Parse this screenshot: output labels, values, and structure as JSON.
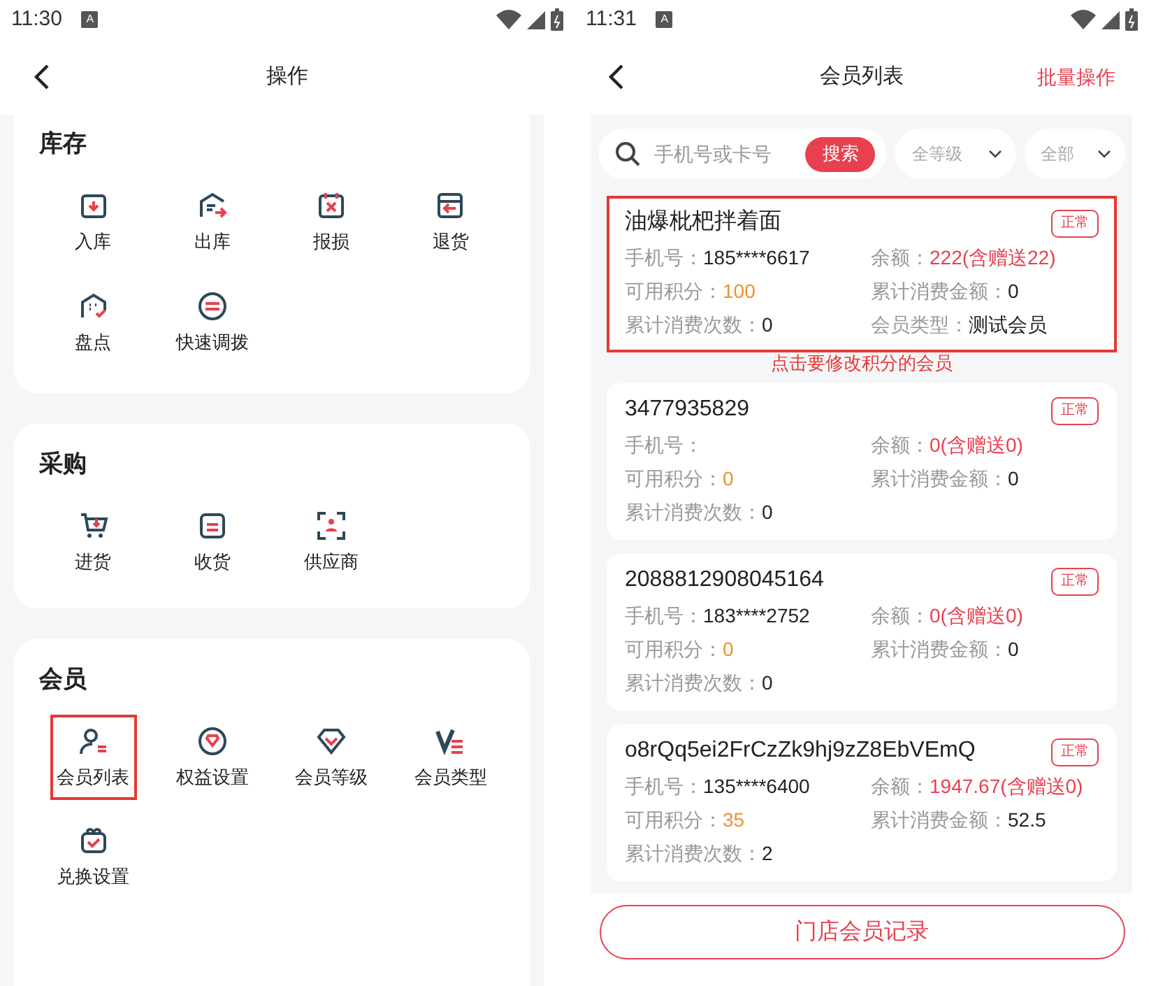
{
  "screens": [
    {
      "status_bar": {
        "time": "11:30",
        "notification": "A"
      },
      "header": {
        "title": "操作"
      },
      "sections": [
        {
          "title": "库存",
          "items": [
            {
              "label": "入库",
              "highlighted": false
            },
            {
              "label": "出库",
              "highlighted": false
            },
            {
              "label": "报损",
              "highlighted": false
            },
            {
              "label": "退货",
              "highlighted": false
            },
            {
              "label": "盘点",
              "highlighted": false
            },
            {
              "label": "快速调拨",
              "highlighted": false
            }
          ]
        },
        {
          "title": "采购",
          "items": [
            {
              "label": "进货",
              "highlighted": false
            },
            {
              "label": "收货",
              "highlighted": false
            },
            {
              "label": "供应商",
              "highlighted": false
            }
          ]
        },
        {
          "title": "会员",
          "items": [
            {
              "label": "会员列表",
              "highlighted": true
            },
            {
              "label": "权益设置",
              "highlighted": false
            },
            {
              "label": "会员等级",
              "highlighted": false
            },
            {
              "label": "会员类型",
              "highlighted": false
            },
            {
              "label": "兑换设置",
              "highlighted": false
            }
          ]
        }
      ]
    },
    {
      "status_bar": {
        "time": "11:31",
        "notification": "A"
      },
      "header": {
        "title": "会员列表",
        "action": "批量操作"
      },
      "search": {
        "placeholder": "手机号或卡号",
        "button": "搜索"
      },
      "filters": [
        "全等级",
        "全部"
      ],
      "members": [
        {
          "name": "油爆枇杷拌着面",
          "status": "正常",
          "highlighted": true,
          "fields": [
            {
              "label": "手机号：",
              "value": "185****6617",
              "kind": "plain"
            },
            {
              "label": "余额：",
              "value": "222(含赠送22)",
              "kind": "balance"
            },
            {
              "label": "可用积分：",
              "value": "100",
              "kind": "points"
            },
            {
              "label": "累计消费金额：",
              "value": "0",
              "kind": "plain"
            },
            {
              "label": "累计消费次数：",
              "value": "0",
              "kind": "plain"
            },
            {
              "label": "会员类型：",
              "value": "测试会员",
              "kind": "plain"
            }
          ]
        },
        {
          "name": "3477935829",
          "status": "正常",
          "highlighted": false,
          "fields": [
            {
              "label": "手机号：",
              "kind": "plain"
            },
            {
              "label": "余额：",
              "value": "0(含赠送0)",
              "kind": "balance"
            },
            {
              "label": "可用积分：",
              "value": "0",
              "kind": "points"
            },
            {
              "label": "累计消费金额：",
              "value": "0",
              "kind": "plain"
            },
            {
              "label": "累计消费次数：",
              "value": "0",
              "kind": "plain"
            }
          ]
        },
        {
          "name": "2088812908045164",
          "status": "正常",
          "highlighted": false,
          "fields": [
            {
              "label": "手机号：",
              "value": "183****2752",
              "kind": "plain"
            },
            {
              "label": "余额：",
              "value": "0(含赠送0)",
              "kind": "balance"
            },
            {
              "label": "可用积分：",
              "value": "0",
              "kind": "points"
            },
            {
              "label": "累计消费金额：",
              "value": "0",
              "kind": "plain"
            },
            {
              "label": "累计消费次数：",
              "value": "0",
              "kind": "plain"
            }
          ]
        },
        {
          "name": "o8rQq5ei2FrCzZk9hj9zZ8EbVEmQ",
          "status": "正常",
          "highlighted": false,
          "fields": [
            {
              "label": "手机号：",
              "value": "135****6400",
              "kind": "plain"
            },
            {
              "label": "余额：",
              "value": "1947.67(含赠送0)",
              "kind": "balance"
            },
            {
              "label": "可用积分：",
              "value": "35",
              "kind": "points"
            },
            {
              "label": "累计消费金额：",
              "value": "52.5",
              "kind": "plain"
            },
            {
              "label": "累计消费次数：",
              "value": "2",
              "kind": "plain"
            }
          ]
        }
      ],
      "annotation": "点击要修改积分的会员",
      "bottom_button": "门店会员记录"
    }
  ]
}
